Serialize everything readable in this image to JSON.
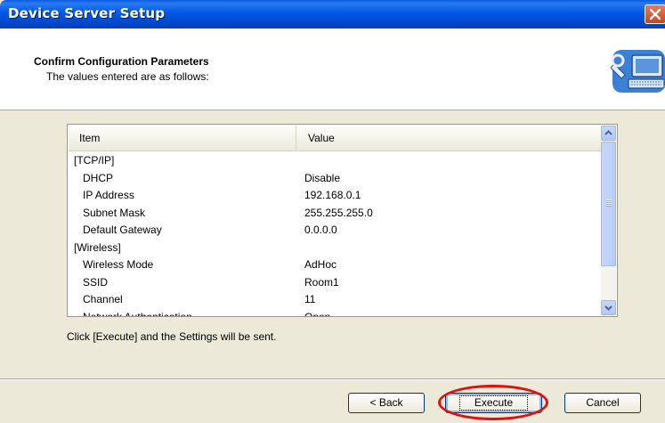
{
  "window": {
    "title": "Device Server Setup"
  },
  "header": {
    "title": "Confirm Configuration Parameters",
    "subtitle": "The values entered are as follows:",
    "icon": "computer-wrench-icon"
  },
  "list": {
    "columns": {
      "item": "Item",
      "value": "Value"
    },
    "rows": [
      {
        "item": "[TCP/IP]",
        "value": "",
        "indent": false
      },
      {
        "item": "DHCP",
        "value": "Disable",
        "indent": true
      },
      {
        "item": "IP Address",
        "value": "192.168.0.1",
        "indent": true
      },
      {
        "item": "Subnet Mask",
        "value": "255.255.255.0",
        "indent": true
      },
      {
        "item": "Default Gateway",
        "value": "0.0.0.0",
        "indent": true
      },
      {
        "item": "[Wireless]",
        "value": "",
        "indent": false
      },
      {
        "item": "Wireless Mode",
        "value": "AdHoc",
        "indent": true
      },
      {
        "item": "SSID",
        "value": "Room1",
        "indent": true
      },
      {
        "item": "Channel",
        "value": "11",
        "indent": true
      },
      {
        "item": "Network Authentication",
        "value": "Open",
        "indent": true
      }
    ]
  },
  "instruction": "Click [Execute] and the Settings will be sent.",
  "buttons": {
    "back": "< Back",
    "execute": "Execute",
    "cancel": "Cancel"
  },
  "colors": {
    "titlebar": "#0058e6",
    "highlight": "#e01010",
    "dialog_bg": "#ece9d8"
  }
}
